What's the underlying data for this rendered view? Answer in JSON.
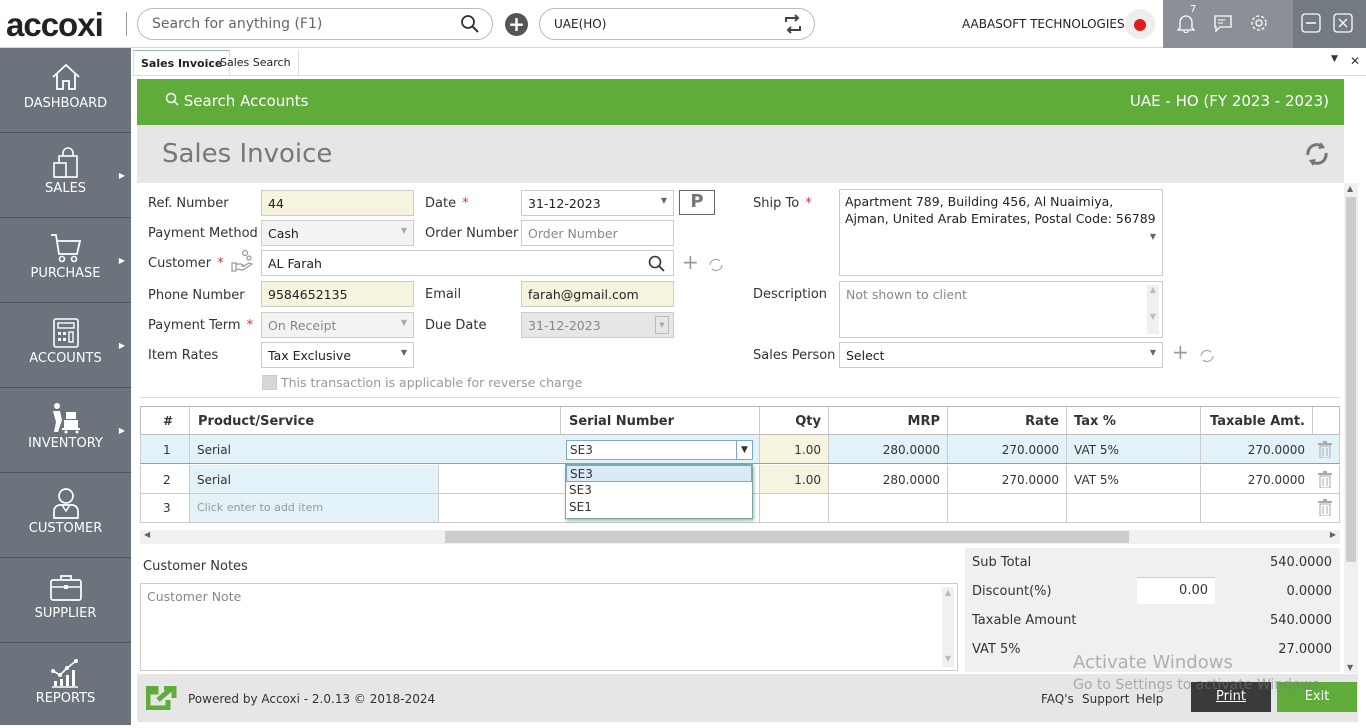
{
  "app": {
    "logo": "accoxi"
  },
  "topbar": {
    "search_placeholder": "Search for anything (F1)",
    "branch": "UAE(HO)",
    "company": "AABASOFT TECHNOLOGIES",
    "notification_count": "7"
  },
  "sidebar": {
    "items": [
      {
        "label": "DASHBOARD",
        "icon": "home-icon",
        "has_submenu": false
      },
      {
        "label": "SALES",
        "icon": "shopping-bag-icon",
        "has_submenu": true
      },
      {
        "label": "PURCHASE",
        "icon": "cart-icon",
        "has_submenu": true
      },
      {
        "label": "ACCOUNTS",
        "icon": "calculator-icon",
        "has_submenu": true
      },
      {
        "label": "INVENTORY",
        "icon": "worker-trolley-icon",
        "has_submenu": true
      },
      {
        "label": "CUSTOMER",
        "icon": "person-icon",
        "has_submenu": false
      },
      {
        "label": "SUPPLIER",
        "icon": "briefcase-icon",
        "has_submenu": false
      },
      {
        "label": "REPORTS",
        "icon": "chart-icon",
        "has_submenu": false
      }
    ]
  },
  "tabs": [
    {
      "label": "Sales Invoice",
      "active": true
    },
    {
      "label": "Sales Search",
      "active": false
    }
  ],
  "header": {
    "search_accounts": "Search Accounts",
    "fiscal": "UAE - HO (FY 2023 - 2023)",
    "title": "Sales Invoice"
  },
  "form": {
    "ref_number": {
      "label": "Ref. Number",
      "value": "44"
    },
    "date": {
      "label": "Date",
      "value": "31-12-2023"
    },
    "payment_method": {
      "label": "Payment Method",
      "value": "Cash"
    },
    "order_number": {
      "label": "Order Number",
      "placeholder": "Order Number"
    },
    "customer": {
      "label": "Customer",
      "value": "AL Farah"
    },
    "phone": {
      "label": "Phone Number",
      "value": "9584652135"
    },
    "email": {
      "label": "Email",
      "value": "farah@gmail.com"
    },
    "payment_term": {
      "label": "Payment Term",
      "value": "On Receipt"
    },
    "due_date": {
      "label": "Due Date",
      "value": "31-12-2023"
    },
    "item_rates": {
      "label": "Item Rates",
      "value": "Tax Exclusive"
    },
    "reverse_charge": {
      "label": "This transaction is applicable for reverse charge",
      "checked": false
    },
    "ship_to": {
      "label": "Ship To",
      "value": "Apartment 789, Building 456, Al Nuaimiya, Ajman, United Arab Emirates, Postal Code: 56789"
    },
    "description": {
      "label": "Description",
      "placeholder": "Not shown to client"
    },
    "sales_person": {
      "label": "Sales Person",
      "value": "Select"
    }
  },
  "table": {
    "columns": [
      "#",
      "Product/Service",
      "Serial Number",
      "Qty",
      "MRP",
      "Rate",
      "Tax %",
      "Taxable Amt."
    ],
    "rows": [
      {
        "no": "1",
        "product": "Serial",
        "serial": "SE3",
        "qty": "1.00",
        "mrp": "280.0000",
        "rate": "270.0000",
        "tax": "VAT 5%",
        "taxable": "270.0000"
      },
      {
        "no": "2",
        "product": "Serial",
        "serial": "",
        "qty": "1.00",
        "mrp": "280.0000",
        "rate": "270.0000",
        "tax": "VAT 5%",
        "taxable": "270.0000"
      },
      {
        "no": "3",
        "product": "Click enter to add item",
        "serial": "",
        "qty": "",
        "mrp": "",
        "rate": "",
        "tax": "",
        "taxable": ""
      }
    ],
    "serial_dropdown_options": [
      "SE3",
      "SE3",
      "SE1"
    ]
  },
  "notes": {
    "label": "Customer Notes",
    "placeholder": "Customer Note"
  },
  "totals": {
    "sub_total": {
      "label": "Sub Total",
      "value": "540.0000"
    },
    "discount": {
      "label": "Discount(%)",
      "input": "0.00",
      "value": "0.0000"
    },
    "taxable_amount": {
      "label": "Taxable Amount",
      "value": "540.0000"
    },
    "vat": {
      "label": "VAT 5%",
      "value": "27.0000"
    }
  },
  "footer": {
    "powered_by": "Powered by Accoxi - 2.0.13 © 2018-2024",
    "links": [
      "FAQ's",
      "Support",
      "Help"
    ],
    "print": "Print",
    "exit": "Exit"
  },
  "watermark": {
    "line1": "Activate Windows",
    "line2": "Go to Settings to activate Windows."
  },
  "colors": {
    "brand_green": "#5fac3a",
    "sidebar": "#6b747c",
    "print_button": "#3a3a3a"
  }
}
